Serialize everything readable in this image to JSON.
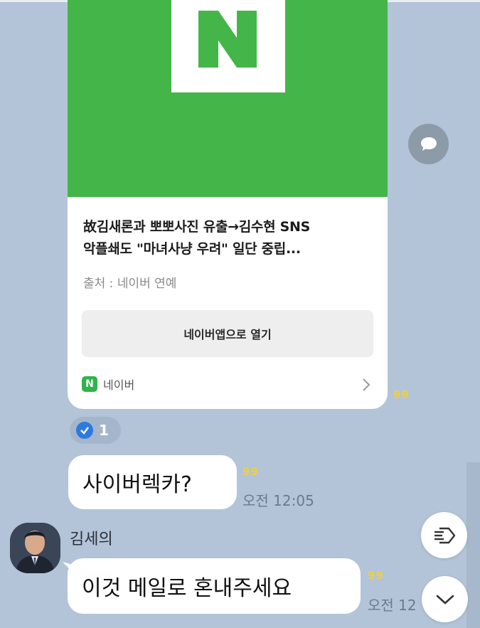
{
  "link_card": {
    "title_line1": "故김새론과 뽀뽀사진 유출→김수현 SNS",
    "title_line2": "악플쇄도 \"마녀사냥 우려\" 일단 중립...",
    "source": "출처 : 네이버 연예",
    "open_button": "네이버앱으로 열기",
    "provider_logo": "N",
    "provider_name": "네이버",
    "thumbnail_color": "#44b649",
    "unread": "99"
  },
  "reaction": {
    "count": "1",
    "icon": "check-circle-icon"
  },
  "messages": [
    {
      "text": "사이버렉카?",
      "unread": "99",
      "time": "오전 12:05"
    },
    {
      "sender": "김세의",
      "text": "이것 메일로 혼내주세요",
      "unread": "99",
      "time": "오전 12"
    }
  ],
  "icons": {
    "share": "speech-bubble-icon",
    "tag": "tag-icon",
    "scroll_down": "chevron-down-icon"
  },
  "colors": {
    "background": "#b3c4d8",
    "bubble": "#ffffff",
    "unread_yellow": "#f0cf3a",
    "reaction_blue": "#2e79e0"
  }
}
